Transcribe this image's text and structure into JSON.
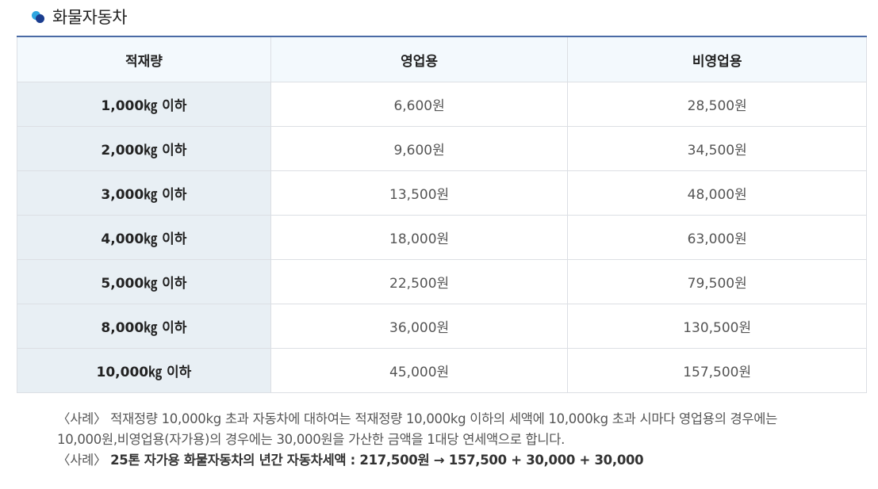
{
  "section": {
    "title": "화물자동차"
  },
  "table": {
    "headers": [
      "적재량",
      "영업용",
      "비영업용"
    ],
    "rows": [
      {
        "weight": "1,000㎏ 이하",
        "commercial": "6,600원",
        "noncommercial": "28,500원"
      },
      {
        "weight": "2,000㎏ 이하",
        "commercial": "9,600원",
        "noncommercial": "34,500원"
      },
      {
        "weight": "3,000㎏ 이하",
        "commercial": "13,500원",
        "noncommercial": "48,000원"
      },
      {
        "weight": "4,000㎏ 이하",
        "commercial": "18,000원",
        "noncommercial": "63,000원"
      },
      {
        "weight": "5,000㎏ 이하",
        "commercial": "22,500원",
        "noncommercial": "79,500원"
      },
      {
        "weight": "8,000㎏ 이하",
        "commercial": "36,000원",
        "noncommercial": "130,500원"
      },
      {
        "weight": "10,000㎏ 이하",
        "commercial": "45,000원",
        "noncommercial": "157,500원"
      }
    ]
  },
  "notes": {
    "line1": "〈사례〉 적재정량 10,000kg 초과 자동차에 대하여는 적재정량 10,000kg 이하의 세액에 10,000kg 초과 시마다 영업용의 경우에는",
    "line2": "10,000원,비영업용(자가용)의 경우에는 30,000원을 가산한 금액을 1대당 연세액으로 합니다.",
    "line3_prefix": "〈사례〉 ",
    "line3_bold": "25톤 자가용 화물자동차의 년간 자동차세액 : 217,500원 → 157,500 + 30,000 + 30,000"
  }
}
